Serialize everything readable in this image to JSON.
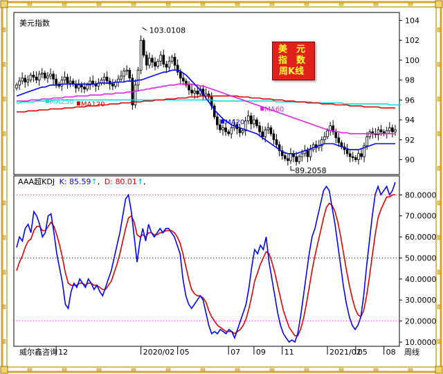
{
  "window": {
    "title": "美元指数",
    "footer_left": "威尔鑫咨询",
    "footer_right": "周线"
  },
  "badge": {
    "line1": "美　元",
    "line2": "指　数",
    "line3": "周K线"
  },
  "indicator": {
    "name": "AAA超KDJ",
    "k_label": "K: 85.59",
    "d_label": "D: 80.01",
    "arrow": "↑"
  },
  "colors": {
    "up_candle": "#ffffff",
    "down_candle": "#000000",
    "ma20": "#0000ff",
    "ma60": "#e020e0",
    "ma120": "#e00000",
    "ma250": "#00e0e0",
    "k_line": "#0000ff",
    "d_line": "#e00000",
    "frame": "#d4a62c"
  },
  "chart_data": [
    {
      "type": "candlestick",
      "title": "美元指数",
      "ylim": [
        88.5,
        104.8
      ],
      "yticks": [
        104,
        102,
        100,
        98,
        96,
        94,
        92,
        90
      ],
      "x_tick_labels": [
        "12",
        "2020/02",
        "05",
        "07",
        "09",
        "11",
        "2021/02",
        "05",
        "08"
      ],
      "annotations": [
        {
          "text": "103.0108",
          "value": 103.0108,
          "note": "high"
        },
        {
          "text": "89.2058",
          "value": 89.2058,
          "note": "low"
        }
      ],
      "ma_labels": [
        {
          "text": "MA20",
          "key": "ma20"
        },
        {
          "text": "MA60",
          "key": "ma60"
        },
        {
          "text": "MA120",
          "key": "ma120"
        },
        {
          "text": "MA250",
          "key": "ma250"
        }
      ],
      "closes": [
        97.5,
        97.9,
        98.2,
        97.8,
        98.0,
        98.5,
        98.3,
        98.0,
        98.6,
        98.7,
        98.2,
        98.4,
        98.6,
        98.1,
        97.6,
        97.4,
        98.0,
        98.3,
        97.7,
        97.9,
        97.6,
        97.2,
        97.5,
        97.3,
        97.1,
        97.5,
        97.9,
        97.6,
        97.4,
        97.7,
        98.0,
        98.3,
        97.9,
        97.6,
        97.4,
        97.8,
        98.1,
        98.4,
        98.9,
        99.0,
        98.2,
        95.5,
        97.5,
        99.0,
        102.0,
        100.5,
        99.5,
        100.2,
        99.8,
        99.4,
        99.9,
        100.5,
        99.6,
        99.3,
        99.9,
        100.3,
        99.5,
        98.8,
        98.2,
        97.9,
        97.5,
        97.0,
        96.7,
        96.9,
        96.6,
        97.1,
        96.4,
        96.6,
        96.3,
        95.4,
        94.3,
        93.5,
        93.0,
        93.2,
        92.8,
        92.6,
        93.2,
        93.5,
        93.1,
        92.7,
        92.9,
        93.9,
        94.4,
        93.6,
        94.0,
        93.4,
        92.8,
        92.3,
        93.0,
        93.2,
        92.6,
        92.0,
        91.5,
        90.9,
        90.4,
        90.1,
        89.9,
        90.6,
        90.3,
        89.8,
        90.3,
        90.6,
        90.9,
        90.3,
        91.0,
        91.5,
        91.2,
        91.4,
        92.0,
        92.3,
        92.9,
        93.4,
        92.8,
        92.2,
        91.7,
        91.3,
        91.0,
        90.6,
        90.3,
        90.2,
        90.0,
        90.6,
        90.3,
        91.4,
        92.3,
        92.8,
        92.6,
        92.5,
        93.0,
        92.8,
        92.6,
        92.9,
        93.2,
        92.8,
        93.0
      ],
      "ma20": [
        96.4,
        96.5,
        96.6,
        96.7,
        96.8,
        96.9,
        97.0,
        97.1,
        97.2,
        97.3,
        97.3,
        97.4,
        97.5,
        97.5,
        97.5,
        97.5,
        97.6,
        97.6,
        97.6,
        97.6,
        97.6,
        97.6,
        97.6,
        97.6,
        97.6,
        97.6,
        97.6,
        97.6,
        97.6,
        97.7,
        97.7,
        97.7,
        97.7,
        97.7,
        97.7,
        97.8,
        97.8,
        97.8,
        97.8,
        97.9,
        97.9,
        97.9,
        97.9,
        98.0,
        98.0,
        98.1,
        98.2,
        98.3,
        98.4,
        98.5,
        98.6,
        98.7,
        98.8,
        98.8,
        98.9,
        99.0,
        99.0,
        99.0,
        98.9,
        98.7,
        98.5,
        98.2,
        97.9,
        97.6,
        97.3,
        97.0,
        96.6,
        96.2,
        95.8,
        95.4,
        95.0,
        94.7,
        94.4,
        94.1,
        93.9,
        93.7,
        93.5,
        93.4,
        93.3,
        93.2,
        93.1,
        93.0,
        92.9,
        92.8,
        92.7,
        92.6,
        92.4,
        92.2,
        92.0,
        91.8,
        91.6,
        91.4,
        91.2,
        91.0,
        90.8,
        90.7,
        90.6,
        90.6,
        90.6,
        90.6,
        90.7,
        90.8,
        90.9,
        91.0,
        91.1,
        91.2,
        91.3,
        91.4,
        91.5,
        91.6,
        91.6,
        91.6,
        91.6,
        91.5,
        91.4,
        91.3,
        91.2,
        91.1,
        91.0,
        91.0,
        91.0,
        91.0,
        91.1,
        91.2,
        91.3,
        91.4,
        91.5,
        91.6,
        91.6,
        91.6,
        91.6,
        91.6,
        91.6,
        91.6,
        91.6
      ],
      "ma60": [
        95.9,
        95.9,
        95.9,
        95.9,
        95.9,
        96.0,
        96.0,
        96.0,
        96.0,
        96.1,
        96.1,
        96.1,
        96.1,
        96.2,
        96.2,
        96.2,
        96.2,
        96.3,
        96.3,
        96.3,
        96.3,
        96.4,
        96.4,
        96.4,
        96.4,
        96.4,
        96.5,
        96.5,
        96.5,
        96.5,
        96.5,
        96.6,
        96.6,
        96.6,
        96.6,
        96.7,
        96.7,
        96.7,
        96.7,
        96.8,
        96.8,
        96.8,
        96.9,
        96.9,
        97.0,
        97.0,
        97.1,
        97.1,
        97.2,
        97.2,
        97.3,
        97.3,
        97.4,
        97.4,
        97.5,
        97.5,
        97.5,
        97.6,
        97.6,
        97.6,
        97.6,
        97.6,
        97.6,
        97.5,
        97.5,
        97.4,
        97.4,
        97.3,
        97.2,
        97.1,
        97.0,
        96.9,
        96.8,
        96.7,
        96.6,
        96.5,
        96.4,
        96.3,
        96.2,
        96.1,
        96.0,
        95.9,
        95.8,
        95.7,
        95.6,
        95.5,
        95.4,
        95.3,
        95.2,
        95.1,
        95.0,
        94.9,
        94.8,
        94.7,
        94.6,
        94.5,
        94.4,
        94.3,
        94.2,
        94.1,
        94.0,
        93.9,
        93.8,
        93.7,
        93.6,
        93.5,
        93.4,
        93.3,
        93.2,
        93.1,
        93.0,
        92.9,
        92.9,
        92.8,
        92.8,
        92.7,
        92.7,
        92.7,
        92.6,
        92.6,
        92.6,
        92.6,
        92.6,
        92.6,
        92.6,
        92.6,
        92.6,
        92.6,
        92.6,
        92.6,
        92.6,
        92.6,
        92.6,
        92.6,
        92.6
      ],
      "ma120": [
        94.8,
        94.8,
        94.8,
        94.8,
        94.9,
        94.9,
        94.9,
        94.9,
        95.0,
        95.0,
        95.0,
        95.0,
        95.1,
        95.1,
        95.1,
        95.1,
        95.1,
        95.2,
        95.2,
        95.2,
        95.2,
        95.3,
        95.3,
        95.3,
        95.3,
        95.4,
        95.4,
        95.4,
        95.4,
        95.5,
        95.5,
        95.5,
        95.5,
        95.6,
        95.6,
        95.6,
        95.6,
        95.7,
        95.7,
        95.7,
        95.7,
        95.8,
        95.8,
        95.8,
        95.8,
        95.9,
        95.9,
        95.9,
        95.9,
        96.0,
        96.0,
        96.0,
        96.0,
        96.1,
        96.1,
        96.1,
        96.1,
        96.2,
        96.2,
        96.2,
        96.2,
        96.3,
        96.3,
        96.3,
        96.3,
        96.4,
        96.4,
        96.4,
        96.4,
        96.4,
        96.4,
        96.4,
        96.4,
        96.4,
        96.4,
        96.4,
        96.4,
        96.4,
        96.4,
        96.3,
        96.3,
        96.3,
        96.3,
        96.2,
        96.2,
        96.2,
        96.2,
        96.1,
        96.1,
        96.1,
        96.1,
        96.0,
        96.0,
        96.0,
        96.0,
        95.9,
        95.9,
        95.9,
        95.9,
        95.8,
        95.8,
        95.8,
        95.8,
        95.7,
        95.7,
        95.7,
        95.7,
        95.7,
        95.6,
        95.6,
        95.6,
        95.6,
        95.6,
        95.5,
        95.5,
        95.5,
        95.5,
        95.5,
        95.4,
        95.4,
        95.4,
        95.4,
        95.4,
        95.3,
        95.3,
        95.3,
        95.3,
        95.3,
        95.3,
        95.2,
        95.2,
        95.2,
        95.2,
        95.2,
        95.2
      ],
      "ma250": [
        95.7,
        95.7,
        95.8,
        95.8,
        95.8,
        95.8,
        95.8,
        95.9,
        95.9,
        95.9,
        95.9,
        95.9,
        95.9,
        96.0,
        96.0,
        96.0,
        96.0,
        96.0,
        96.0,
        96.0,
        96.0,
        96.0,
        96.0,
        96.0,
        96.0,
        96.0,
        96.0,
        96.0,
        96.0,
        96.0,
        96.0,
        96.0,
        96.0,
        96.0,
        96.0,
        96.0,
        96.0,
        96.0,
        96.0,
        96.0,
        96.0,
        96.0,
        96.0,
        96.0,
        96.0,
        96.0,
        96.0,
        96.0,
        96.0,
        96.0,
        96.0,
        96.0,
        96.0,
        96.0,
        96.0,
        96.0,
        96.0,
        96.0,
        96.0,
        96.0,
        96.0,
        96.0,
        96.0,
        96.0,
        96.0,
        96.0,
        96.0,
        96.0,
        96.0,
        96.0,
        95.9,
        95.9,
        95.9,
        95.9,
        95.9,
        95.9,
        95.9,
        95.9,
        95.9,
        95.9,
        95.9,
        95.9,
        95.9,
        95.9,
        95.9,
        95.9,
        95.9,
        95.9,
        95.9,
        95.9,
        95.9,
        95.9,
        95.8,
        95.8,
        95.8,
        95.8,
        95.8,
        95.8,
        95.8,
        95.8,
        95.8,
        95.8,
        95.8,
        95.8,
        95.8,
        95.7,
        95.7,
        95.7,
        95.7,
        95.7,
        95.7,
        95.7,
        95.7,
        95.7,
        95.7,
        95.7,
        95.6,
        95.6,
        95.6,
        95.6,
        95.6,
        95.6,
        95.6,
        95.6,
        95.6,
        95.6,
        95.6,
        95.6,
        95.6,
        95.6,
        95.6,
        95.6,
        95.5,
        95.5,
        95.5,
        95.5,
        95.5
      ]
    },
    {
      "type": "line",
      "title": "AAA超KDJ",
      "ylim": [
        8,
        89
      ],
      "yticks": [
        80.0,
        70.0,
        60.0,
        50.0,
        40.0,
        30.0,
        20.0,
        10.0
      ],
      "ytick_labels": [
        "80.0000",
        "70.0000",
        "60.0000",
        "50.0000",
        "40.0000",
        "30.0000",
        "20.0000",
        "10.0000"
      ],
      "reference_lines": [
        80,
        50,
        20
      ],
      "series": [
        {
          "name": "K",
          "values": [
            55,
            60,
            58,
            64,
            66,
            62,
            72,
            70,
            66,
            60,
            62,
            70,
            71,
            62,
            52,
            45,
            38,
            28,
            26,
            34,
            38,
            36,
            40,
            38,
            36,
            40,
            38,
            35,
            37,
            34,
            32,
            36,
            40,
            44,
            50,
            56,
            62,
            70,
            78,
            80,
            72,
            60,
            48,
            58,
            64,
            58,
            66,
            62,
            60,
            62,
            64,
            62,
            64,
            64,
            62,
            60,
            56,
            52,
            40,
            32,
            28,
            26,
            28,
            30,
            32,
            30,
            24,
            18,
            14,
            15,
            14,
            16,
            15,
            14,
            16,
            15,
            12,
            16,
            20,
            24,
            28,
            36,
            46,
            54,
            52,
            56,
            54,
            60,
            48,
            40,
            32,
            24,
            18,
            14,
            12,
            10,
            11,
            10,
            14,
            22,
            32,
            42,
            52,
            60,
            64,
            70,
            76,
            82,
            84,
            82,
            74,
            66,
            56,
            46,
            36,
            28,
            22,
            18,
            16,
            18,
            22,
            32,
            46,
            58,
            70,
            80,
            84,
            80,
            82,
            84,
            80,
            82,
            86
          ]
        },
        {
          "name": "D",
          "values": [
            44,
            48,
            51,
            55,
            58,
            59,
            63,
            65,
            65,
            63,
            63,
            65,
            67,
            65,
            61,
            56,
            50,
            43,
            38,
            37,
            37,
            37,
            38,
            38,
            37,
            38,
            38,
            37,
            37,
            36,
            35,
            35,
            37,
            39,
            43,
            47,
            52,
            58,
            64,
            69,
            70,
            67,
            61,
            60,
            61,
            60,
            62,
            62,
            61,
            61,
            62,
            62,
            63,
            63,
            63,
            62,
            60,
            57,
            52,
            46,
            40,
            35,
            33,
            32,
            32,
            31,
            29,
            25,
            22,
            20,
            18,
            17,
            16,
            15,
            15,
            15,
            14,
            15,
            16,
            18,
            21,
            26,
            32,
            39,
            43,
            47,
            50,
            53,
            52,
            48,
            43,
            37,
            31,
            25,
            21,
            17,
            15,
            13,
            13,
            16,
            21,
            28,
            36,
            44,
            51,
            57,
            63,
            69,
            74,
            76,
            75,
            72,
            67,
            60,
            52,
            44,
            37,
            31,
            26,
            23,
            22,
            25,
            32,
            41,
            51,
            61,
            69,
            73,
            76,
            79,
            79,
            80,
            80
          ]
        }
      ]
    }
  ]
}
